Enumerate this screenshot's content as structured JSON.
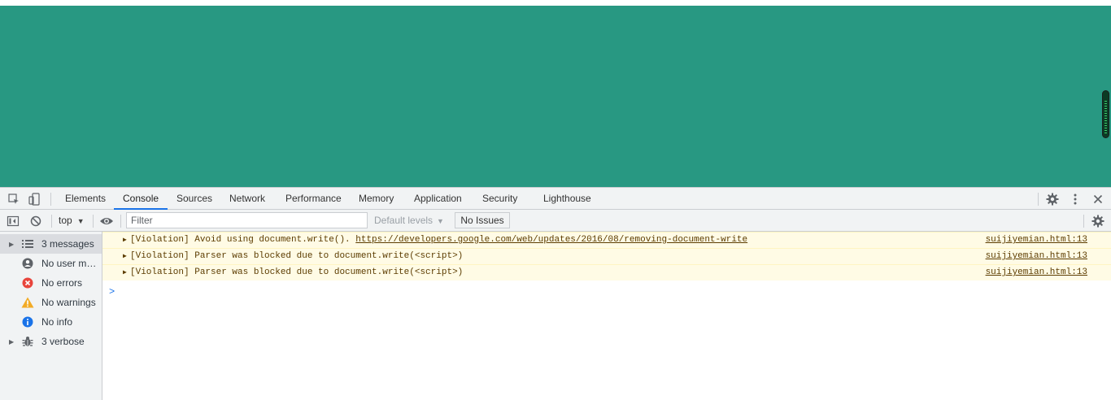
{
  "page": {
    "viewport_color": "#289882"
  },
  "devtools": {
    "tabs": [
      {
        "label": "Elements"
      },
      {
        "label": "Console"
      },
      {
        "label": "Sources"
      },
      {
        "label": "Network"
      },
      {
        "label": "Performance"
      },
      {
        "label": "Memory"
      },
      {
        "label": "Application"
      },
      {
        "label": "Security"
      },
      {
        "label": "Lighthouse"
      }
    ],
    "active_tab": "Console",
    "toolbar": {
      "context": "top",
      "filter_placeholder": "Filter",
      "levels": "Default levels",
      "issues": "No Issues"
    },
    "sidebar": [
      {
        "label": "3 messages",
        "icon": "list-icon",
        "expandable": true,
        "selected": true
      },
      {
        "label": "No user messages",
        "icon": "user-icon",
        "expandable": false
      },
      {
        "label": "No errors",
        "icon": "error-icon",
        "expandable": false
      },
      {
        "label": "No warnings",
        "icon": "warning-icon",
        "expandable": false
      },
      {
        "label": "No info",
        "icon": "info-icon",
        "expandable": false
      },
      {
        "label": "3 verbose",
        "icon": "bug-icon",
        "expandable": true
      }
    ],
    "messages": [
      {
        "text": "[Violation] Avoid using document.write(). ",
        "link": "https://developers.google.com/web/updates/2016/08/removing-document-write",
        "source": "suijiyemian.html:13"
      },
      {
        "text": "[Violation] Parser was blocked due to document.write(<script>)",
        "link": "",
        "source": "suijiyemian.html:13"
      },
      {
        "text": "[Violation] Parser was blocked due to document.write(<script>)",
        "link": "",
        "source": "suijiyemian.html:13"
      }
    ],
    "prompt_symbol": ">"
  }
}
